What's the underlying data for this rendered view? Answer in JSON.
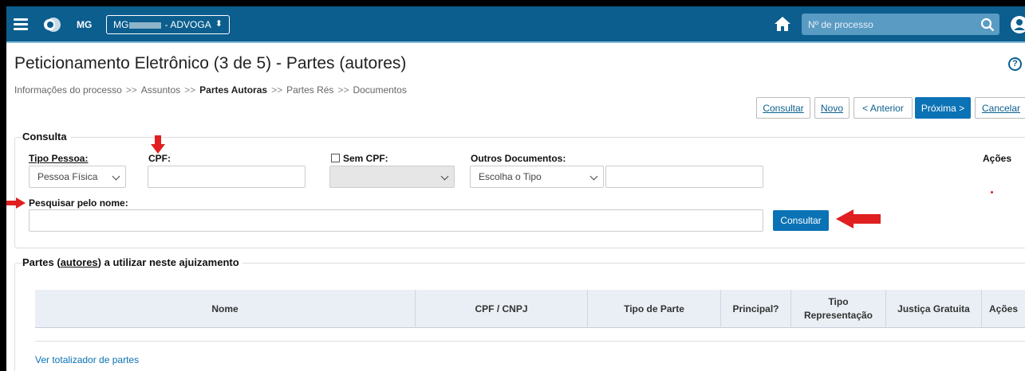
{
  "topbar": {
    "tribunal": "MG",
    "org_select_prefix": "MG",
    "org_select_suffix": " - ADVOGA",
    "process_search_placeholder": "Nº de processo"
  },
  "page": {
    "title": "Peticionamento Eletrônico (3 de 5) - Partes (autores)",
    "help_glyph": "?"
  },
  "breadcrumb": {
    "items": [
      "Informações do processo",
      "Assuntos",
      "Partes Autoras",
      "Partes Rés",
      "Documentos"
    ],
    "separator": ">>"
  },
  "actions": {
    "consultar": "Consultar",
    "novo": "Novo",
    "anterior": "< Anterior",
    "proxima": "Próxima >",
    "cancelar": "Cancelar"
  },
  "consulta": {
    "legend": "Consulta",
    "tipo_pessoa_label": "Tipo Pessoa:",
    "tipo_pessoa_value": "Pessoa Física",
    "cpf_label": "CPF:",
    "sem_cpf_label": "Sem CPF:",
    "outros_docs_label": "Outros Documentos:",
    "outros_docs_value": "Escolha o Tipo",
    "acoes_label": "Ações",
    "nome_label": "Pesquisar pelo nome:",
    "consultar_button": "Consultar"
  },
  "partes": {
    "legend_prefix": "Partes (",
    "legend_link": "autores",
    "legend_suffix": ") a utilizar neste ajuizamento",
    "columns": [
      "Nome",
      "CPF / CNPJ",
      "Tipo de Parte",
      "Principal?",
      "Tipo Representação",
      "Justiça Gratuita",
      "Ações"
    ],
    "totalizador_link": "Ver totalizador de partes"
  },
  "colors": {
    "topbar": "#0b5e8e",
    "primary_button": "#0b72b5",
    "annotation_arrow": "#e02020"
  }
}
